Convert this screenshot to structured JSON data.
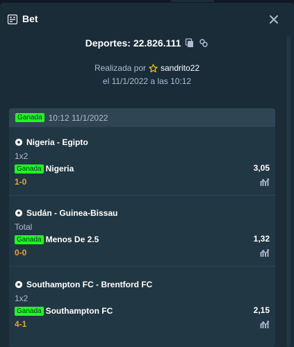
{
  "header": {
    "title": "Bet",
    "title_icon": "ticket-icon",
    "close_icon": "close-icon"
  },
  "summary": {
    "label": "Deportes: 22.826.111",
    "copy_icon": "copy-icon",
    "link_icon": "link-icon",
    "placed_by": "Realizada por",
    "user_icon": "star-icon",
    "username": "sandrito22",
    "date": "el 11/1/2022 a las 10:12"
  },
  "card": {
    "status": "Ganada",
    "time": "10:12 11/1/2022",
    "legs": [
      {
        "match": "Nigeria - Egipto",
        "market": "1x2",
        "status": "Ganada",
        "selection": "Nigeria",
        "odds": "3,05",
        "score": "1-0"
      },
      {
        "match": "Sudán - Guinea-Bissau",
        "market": "Total",
        "status": "Ganada",
        "selection": "Menos De 2.5",
        "odds": "1,32",
        "score": "0-0"
      },
      {
        "match": "Southampton FC - Brentford FC",
        "market": "1x2",
        "status": "Ganada",
        "selection": "Southampton FC",
        "odds": "2,15",
        "score": "4-1"
      }
    ]
  },
  "colors": {
    "background": "#0f1923",
    "panel": "#1a2c38",
    "card": "#213743",
    "win_badge": "#1fff20",
    "score": "#e9a13b",
    "muted_text": "#b1bad3"
  }
}
